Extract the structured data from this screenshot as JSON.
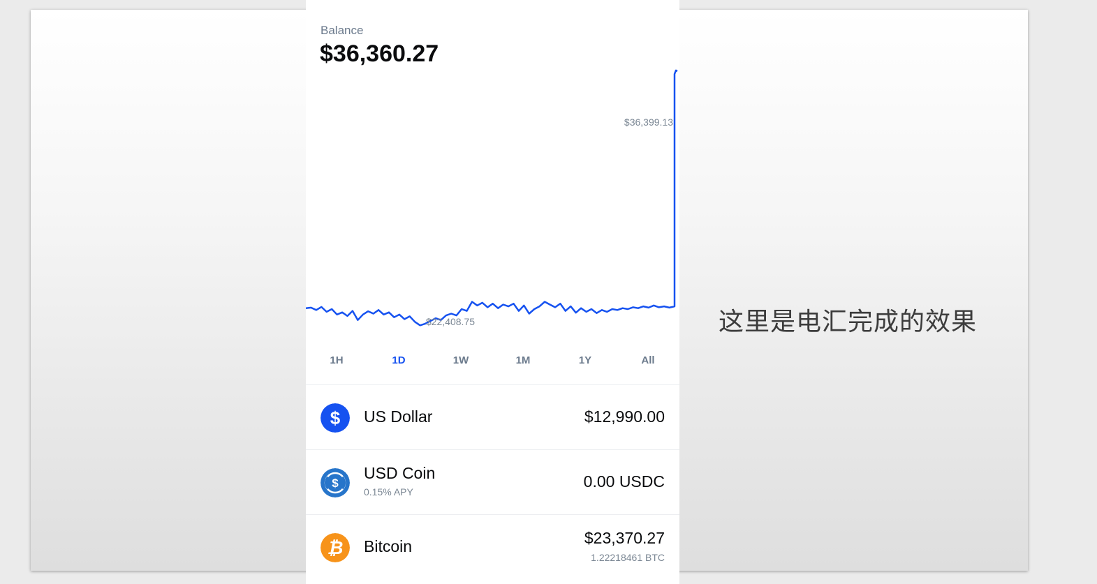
{
  "caption": "这里是电汇完成的效果",
  "balance": {
    "label": "Balance",
    "value": "$36,360.27"
  },
  "chart_data": {
    "type": "line",
    "title": "",
    "high_label": "$36,399.13",
    "low_label": "$22,408.75",
    "ylim": [
      21500,
      37200
    ],
    "series": [
      {
        "values": [
          23350,
          23380,
          23250,
          23420,
          23150,
          23300,
          23000,
          23120,
          22920,
          23200,
          22700,
          23000,
          23180,
          23050,
          23250,
          23000,
          23120,
          22850,
          23000,
          22750,
          22900,
          22600,
          22409,
          22500,
          22650,
          22800,
          22700,
          22950,
          23050,
          22950,
          23300,
          23200,
          23700,
          23500,
          23650,
          23400,
          23600,
          23350,
          23550,
          23450,
          23600,
          23200,
          23500,
          23050,
          23300,
          23450,
          23700,
          23550,
          23400,
          23600,
          23200,
          23450,
          23100,
          23350,
          23150,
          23300,
          23080,
          23250,
          23150,
          23300,
          23250,
          23350,
          23300,
          23400,
          23350,
          23450,
          23380,
          23500,
          23400,
          23450,
          23380,
          23450,
          36200,
          36399,
          36360
        ]
      }
    ],
    "range_buttons": [
      "1H",
      "1D",
      "1W",
      "1M",
      "1Y",
      "All"
    ],
    "active_range": "1D",
    "line_color": "#1652f0",
    "grid": false
  },
  "assets": [
    {
      "icon": "dollar-icon",
      "icon_color": "#1652f0",
      "name": "US Dollar",
      "sub": "",
      "value": "$12,990.00",
      "subvalue": ""
    },
    {
      "icon": "usdc-icon",
      "icon_color": "#2775ca",
      "name": "USD Coin",
      "sub": "0.15% APY",
      "value": "0.00 USDC",
      "subvalue": ""
    },
    {
      "icon": "bitcoin-icon",
      "icon_color": "#f7931a",
      "name": "Bitcoin",
      "sub": "",
      "value": "$23,370.27",
      "subvalue": "1.22218461 BTC"
    }
  ]
}
